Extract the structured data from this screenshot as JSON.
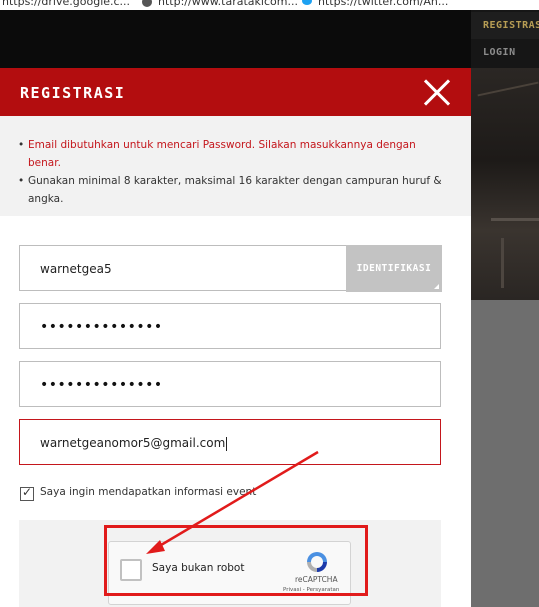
{
  "browser": {
    "bookmarks": [
      "https://drive.google.c...",
      "http://www.taratakicom...",
      "https://twitter.com/Ah..."
    ]
  },
  "site_nav": {
    "items": [
      "REGISTRASI",
      "LOGIN"
    ],
    "active": "REGISTRASI"
  },
  "modal": {
    "title": "REGISTRASI",
    "close_icon": "close-icon",
    "info": {
      "error_line": "Email dibutuhkan untuk mencari Password. Silakan masukkannya dengan benar.",
      "hint_line": "Gunakan minimal 8 karakter, maksimal 16 karakter dengan campuran huruf & angka."
    },
    "form": {
      "username": "warnetgea5",
      "identify_button": "IDENTIFIKASI",
      "password_mask": "••••••••••••••",
      "confirm_password_mask": "••••••••••••••",
      "email": "warnetgeanomor5@gmail.com",
      "newsletter_checked": true,
      "newsletter_label": "Saya ingin mendapatkan informasi event"
    },
    "recaptcha": {
      "label": "Saya bukan robot",
      "brand": "reCAPTCHA",
      "links": "Privasi - Persyaratan",
      "checked": false
    }
  },
  "annotation": {
    "color": "#e11b1b",
    "shapes": [
      "rectangle",
      "arrow"
    ]
  },
  "colors": {
    "header_red": "#b30d0f",
    "error_red": "#c4161c",
    "nav_active": "#b79d54"
  }
}
